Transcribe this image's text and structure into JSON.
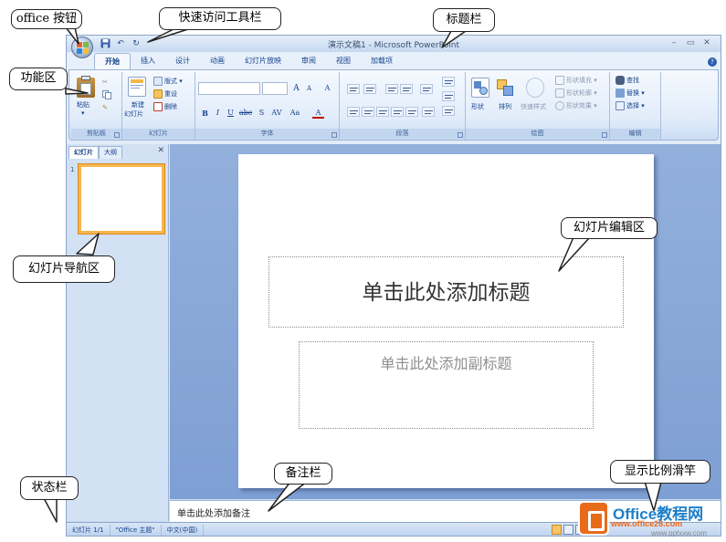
{
  "window": {
    "title": "演示文稿1 - Microsoft PowerPoint",
    "minimize_glyph": "–",
    "maximize_glyph": "▭",
    "close_glyph": "✕"
  },
  "quick_access": {
    "save_icon": "save-icon",
    "undo_icon": "undo-icon",
    "redo_icon": "redo-icon"
  },
  "ribbon": {
    "tabs": [
      {
        "label": "开始",
        "active": true
      },
      {
        "label": "插入"
      },
      {
        "label": "设计"
      },
      {
        "label": "动画"
      },
      {
        "label": "幻灯片放映"
      },
      {
        "label": "审阅"
      },
      {
        "label": "视图"
      },
      {
        "label": "加载项"
      }
    ],
    "help_glyph": "?",
    "groups": {
      "clipboard": {
        "label": "剪贴板",
        "paste_label": "粘贴"
      },
      "slides": {
        "label": "幻灯片",
        "new_slide_label": "新建",
        "new_slide_label2": "幻灯片",
        "layout_label": "版式",
        "reset_label": "重设",
        "delete_label": "删除"
      },
      "font": {
        "label": "字体",
        "grow_label": "A",
        "shrink_label": "A",
        "clear_label": "A",
        "bold": "B",
        "italic": "I",
        "underline": "U",
        "strike": "abc",
        "shadow": "S",
        "spacing": "AV",
        "case": "Aa",
        "color": "A"
      },
      "paragraph": {
        "label": "段落"
      },
      "drawing": {
        "label": "绘图",
        "shapes_label": "形状",
        "arrange_label": "排列",
        "quick_styles_label": "快速样式",
        "fill_label": "形状填充",
        "outline_label": "形状轮廓",
        "effects_label": "形状效果"
      },
      "editing": {
        "label": "编辑",
        "find_label": "查找",
        "replace_label": "替换",
        "select_label": "选择"
      }
    }
  },
  "panel": {
    "tabs": [
      {
        "label": "幻灯片",
        "active": true
      },
      {
        "label": "大纲"
      }
    ],
    "close_glyph": "✕",
    "thumbnail_number": "1"
  },
  "slide": {
    "title_placeholder": "单击此处添加标题",
    "subtitle_placeholder": "单击此处添加副标题"
  },
  "notes_placeholder": "单击此处添加备注",
  "status_bar": {
    "slide_count": "幻灯片 1/1",
    "theme": "\"Office 主题\"",
    "language": "中文(中国)"
  },
  "callouts": {
    "office_button": "office 按钮",
    "quick_access_toolbar": "快速访问工具栏",
    "title_bar": "标题栏",
    "ribbon": "功能区",
    "slide_navigation": "幻灯片导航区",
    "slide_editor": "幻灯片编辑区",
    "notes_pane": "备注栏",
    "status_bar": "状态栏",
    "zoom_slider": "显示比例滑竿"
  },
  "watermark": {
    "title": "Office教程网",
    "url1": "www.office26.com",
    "url2": "www.pptxxw.com"
  },
  "colors": {
    "accent": "#e86b1a",
    "ribbon_blue": "#15428b",
    "thumb_selected": "#f6b64e"
  }
}
